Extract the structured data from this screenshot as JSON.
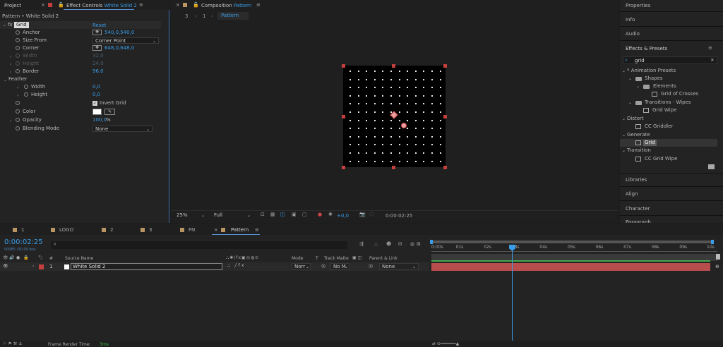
{
  "left_panel": {
    "tabs": {
      "project": "Project",
      "effect_controls_prefix": "Effect Controls",
      "effect_controls_layer": "White Solid 2"
    },
    "header": "Pattern • White Solid 2",
    "effect": {
      "name": "Grid",
      "reset": "Reset"
    },
    "props": {
      "anchor": {
        "label": "Anchor",
        "value": "540,0,540,0"
      },
      "size_from": {
        "label": "Size From",
        "value": "Corner Point"
      },
      "corner": {
        "label": "Corner",
        "value": "648,0,648,0"
      },
      "width": {
        "label": "Width",
        "value": "32,0"
      },
      "height": {
        "label": "Height",
        "value": "24,0"
      },
      "border": {
        "label": "Border",
        "value": "96,0"
      },
      "feather": {
        "label": "Feather"
      },
      "f_width": {
        "label": "Width",
        "value": "0,0"
      },
      "f_height": {
        "label": "Height",
        "value": "0,0"
      },
      "invert": {
        "label": "Invert Grid"
      },
      "color": {
        "label": "Color"
      },
      "opacity": {
        "label": "Opacity",
        "value": "100,0",
        "unit": "%"
      },
      "blending": {
        "label": "Blending Mode",
        "value": "None"
      }
    }
  },
  "composition": {
    "tab_prefix": "Composition",
    "tab_name": "Pattern",
    "breadcrumb": {
      "nav1": "3",
      "nav2": "1",
      "current": "Pattern"
    },
    "footer": {
      "zoom": "25%",
      "quality": "Full",
      "exposure": "+0,0",
      "timecode": "0:00:02:25"
    }
  },
  "right_panel": {
    "headers": {
      "properties": "Properties",
      "info": "Info",
      "audio": "Audio",
      "effects_presets": "Effects & Presets",
      "libraries": "Libraries",
      "align": "Align",
      "character": "Character",
      "paragraph": "Paragraph"
    },
    "search_value": "grid",
    "tree": {
      "animation_presets": "* Animation Presets",
      "shapes": "Shapes",
      "elements": "Elements",
      "grid_of_crosses": "Grid of Crosses",
      "transitions_wipes": "Transitions - Wipes",
      "grid_wipe": "Grid Wipe",
      "distort": "Distort",
      "cc_griddler": "CC Griddler",
      "generate": "Generate",
      "grid": "Grid",
      "transition": "Transition",
      "cc_grid_wipe": "CC Grid Wipe"
    }
  },
  "timeline": {
    "tabs": {
      "t1": "1",
      "logo": "LOGO",
      "t2": "2",
      "t3": "3",
      "fn": "FN",
      "pattern": "Pattern"
    },
    "timecode": "0:00:02:25",
    "timecode_sub": "00085 (30.00 fps)",
    "col_headers": {
      "hash": "#",
      "source_name": "Source Name",
      "mode": "Mode",
      "t": "T",
      "track_matte": "Track Matte",
      "parent_link": "Parent & Link"
    },
    "layer": {
      "index": "1",
      "name": "White Solid 2",
      "mode": "Norr",
      "matte": "No M",
      "parent": "None"
    },
    "ruler": [
      "0:00s",
      "01s",
      "02s",
      "03s",
      "04s",
      "05s",
      "06s",
      "07s",
      "08s",
      "09s",
      "10s"
    ],
    "footer": {
      "render_label": "Frame Render Time:",
      "render_value": "3ms"
    }
  },
  "colors": {
    "accent": "#3a9de8",
    "label_red": "#c4403f",
    "label_tan": "#b99563",
    "track_bar": "#b84d4d",
    "track_green": "#47a84c"
  }
}
